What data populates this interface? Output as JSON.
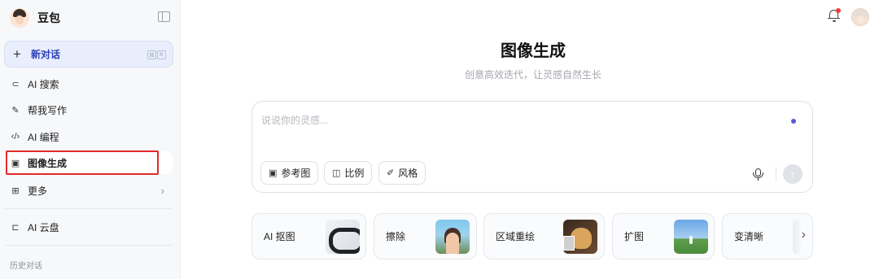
{
  "sidebar": {
    "brand_name": "豆包",
    "new_chat": {
      "label": "新对话",
      "shortcut": [
        "⌘",
        "K"
      ]
    },
    "items": [
      {
        "label": "AI 搜索",
        "icon": "search-spark-icon"
      },
      {
        "label": "帮我写作",
        "icon": "magic-pen-icon"
      },
      {
        "label": "AI 编程",
        "icon": "code-icon"
      },
      {
        "label": "图像生成",
        "icon": "image-edit-icon",
        "active": true
      },
      {
        "label": "更多",
        "icon": "grid-plus-icon"
      },
      {
        "label": "AI 云盘",
        "icon": "cloud-folder-icon"
      }
    ],
    "history_label": "历史对话"
  },
  "header": {
    "notification_badge": true
  },
  "main": {
    "title": "图像生成",
    "subtitle": "创意高效迭代，让灵感自然生长",
    "composer": {
      "placeholder": "说说你的灵感...",
      "chips": [
        {
          "label": "参考图",
          "icon": "image-icon"
        },
        {
          "label": "比例",
          "icon": "aspect-ratio-icon"
        },
        {
          "label": "风格",
          "icon": "brush-icon"
        }
      ]
    },
    "tools": [
      {
        "label": "AI 抠图"
      },
      {
        "label": "擦除"
      },
      {
        "label": "区域重绘"
      },
      {
        "label": "扩图"
      },
      {
        "label": "变清晰"
      }
    ]
  },
  "colors": {
    "accent": "#2b3cb8",
    "highlight_box": "#e12b2b",
    "status_dot": "#5b5bd6",
    "notification_dot": "#f23c3c"
  }
}
